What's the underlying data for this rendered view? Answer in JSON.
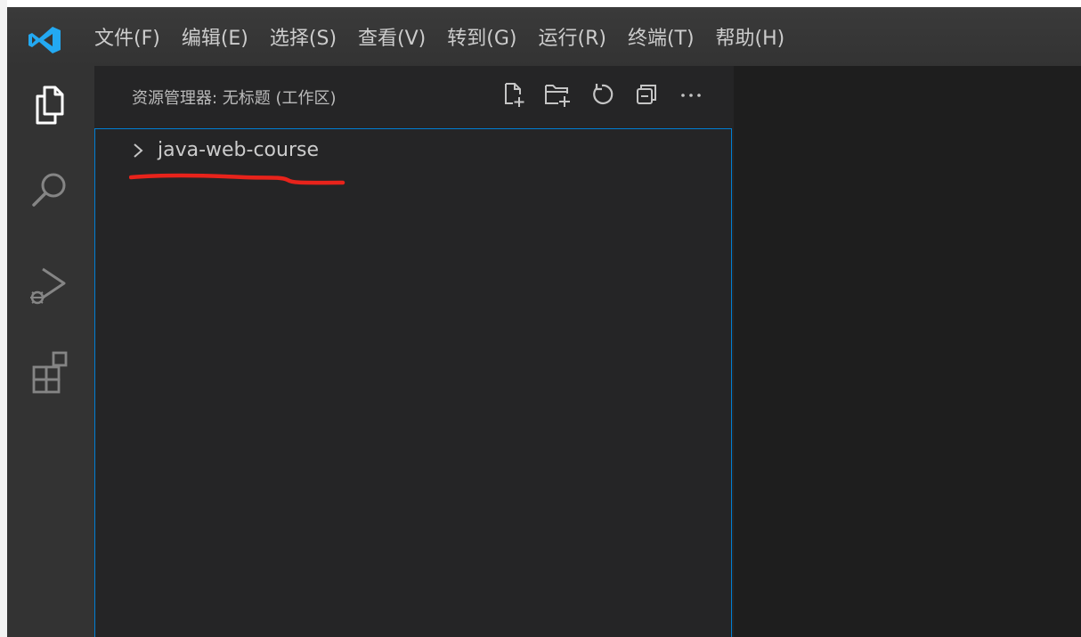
{
  "app": {
    "logo_icon": "vscode-logo-icon",
    "accent_color": "#007fd4",
    "logo_color": "#23a9f2"
  },
  "menu": {
    "items": [
      {
        "label": "文件(F)"
      },
      {
        "label": "编辑(E)"
      },
      {
        "label": "选择(S)"
      },
      {
        "label": "查看(V)"
      },
      {
        "label": "转到(G)"
      },
      {
        "label": "运行(R)"
      },
      {
        "label": "终端(T)"
      },
      {
        "label": "帮助(H)"
      }
    ]
  },
  "activity_bar": {
    "items": [
      {
        "icon": "explorer-icon"
      },
      {
        "icon": "search-icon"
      },
      {
        "icon": "run-debug-icon"
      },
      {
        "icon": "extensions-icon"
      }
    ]
  },
  "sidebar": {
    "title": "资源管理器: 无标题 (工作区)",
    "actions": [
      {
        "icon": "new-file-icon"
      },
      {
        "icon": "new-folder-icon"
      },
      {
        "icon": "refresh-icon"
      },
      {
        "icon": "collapse-all-icon"
      },
      {
        "icon": "more-actions-icon"
      }
    ],
    "tree": {
      "folder_name": "java-web-course",
      "expanded_icon": "chevron-right-icon"
    }
  },
  "annotation": {
    "underline_color": "#e8231b"
  }
}
